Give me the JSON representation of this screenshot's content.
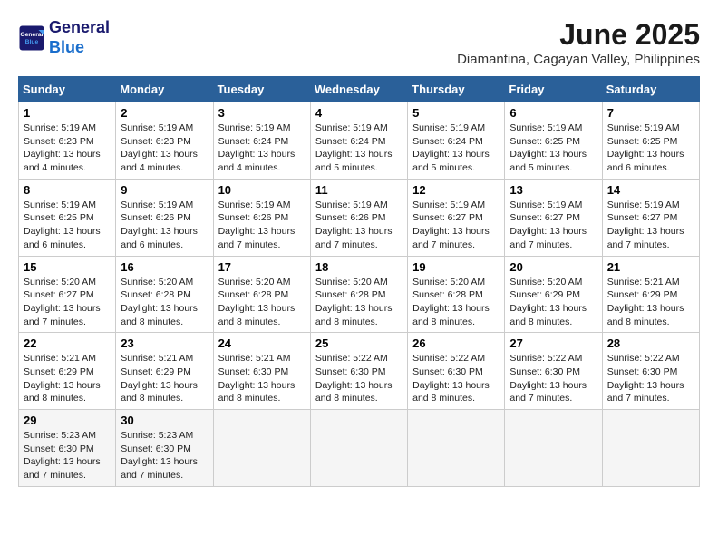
{
  "logo": {
    "line1": "General",
    "line2": "Blue"
  },
  "title": "June 2025",
  "subtitle": "Diamantina, Cagayan Valley, Philippines",
  "days_of_week": [
    "Sunday",
    "Monday",
    "Tuesday",
    "Wednesday",
    "Thursday",
    "Friday",
    "Saturday"
  ],
  "weeks": [
    [
      {
        "day": "1",
        "sunrise": "5:19 AM",
        "sunset": "6:23 PM",
        "daylight": "13 hours and 4 minutes."
      },
      {
        "day": "2",
        "sunrise": "5:19 AM",
        "sunset": "6:23 PM",
        "daylight": "13 hours and 4 minutes."
      },
      {
        "day": "3",
        "sunrise": "5:19 AM",
        "sunset": "6:24 PM",
        "daylight": "13 hours and 4 minutes."
      },
      {
        "day": "4",
        "sunrise": "5:19 AM",
        "sunset": "6:24 PM",
        "daylight": "13 hours and 5 minutes."
      },
      {
        "day": "5",
        "sunrise": "5:19 AM",
        "sunset": "6:24 PM",
        "daylight": "13 hours and 5 minutes."
      },
      {
        "day": "6",
        "sunrise": "5:19 AM",
        "sunset": "6:25 PM",
        "daylight": "13 hours and 5 minutes."
      },
      {
        "day": "7",
        "sunrise": "5:19 AM",
        "sunset": "6:25 PM",
        "daylight": "13 hours and 6 minutes."
      }
    ],
    [
      {
        "day": "8",
        "sunrise": "5:19 AM",
        "sunset": "6:25 PM",
        "daylight": "13 hours and 6 minutes."
      },
      {
        "day": "9",
        "sunrise": "5:19 AM",
        "sunset": "6:26 PM",
        "daylight": "13 hours and 6 minutes."
      },
      {
        "day": "10",
        "sunrise": "5:19 AM",
        "sunset": "6:26 PM",
        "daylight": "13 hours and 7 minutes."
      },
      {
        "day": "11",
        "sunrise": "5:19 AM",
        "sunset": "6:26 PM",
        "daylight": "13 hours and 7 minutes."
      },
      {
        "day": "12",
        "sunrise": "5:19 AM",
        "sunset": "6:27 PM",
        "daylight": "13 hours and 7 minutes."
      },
      {
        "day": "13",
        "sunrise": "5:19 AM",
        "sunset": "6:27 PM",
        "daylight": "13 hours and 7 minutes."
      },
      {
        "day": "14",
        "sunrise": "5:19 AM",
        "sunset": "6:27 PM",
        "daylight": "13 hours and 7 minutes."
      }
    ],
    [
      {
        "day": "15",
        "sunrise": "5:20 AM",
        "sunset": "6:27 PM",
        "daylight": "13 hours and 7 minutes."
      },
      {
        "day": "16",
        "sunrise": "5:20 AM",
        "sunset": "6:28 PM",
        "daylight": "13 hours and 8 minutes."
      },
      {
        "day": "17",
        "sunrise": "5:20 AM",
        "sunset": "6:28 PM",
        "daylight": "13 hours and 8 minutes."
      },
      {
        "day": "18",
        "sunrise": "5:20 AM",
        "sunset": "6:28 PM",
        "daylight": "13 hours and 8 minutes."
      },
      {
        "day": "19",
        "sunrise": "5:20 AM",
        "sunset": "6:28 PM",
        "daylight": "13 hours and 8 minutes."
      },
      {
        "day": "20",
        "sunrise": "5:20 AM",
        "sunset": "6:29 PM",
        "daylight": "13 hours and 8 minutes."
      },
      {
        "day": "21",
        "sunrise": "5:21 AM",
        "sunset": "6:29 PM",
        "daylight": "13 hours and 8 minutes."
      }
    ],
    [
      {
        "day": "22",
        "sunrise": "5:21 AM",
        "sunset": "6:29 PM",
        "daylight": "13 hours and 8 minutes."
      },
      {
        "day": "23",
        "sunrise": "5:21 AM",
        "sunset": "6:29 PM",
        "daylight": "13 hours and 8 minutes."
      },
      {
        "day": "24",
        "sunrise": "5:21 AM",
        "sunset": "6:30 PM",
        "daylight": "13 hours and 8 minutes."
      },
      {
        "day": "25",
        "sunrise": "5:22 AM",
        "sunset": "6:30 PM",
        "daylight": "13 hours and 8 minutes."
      },
      {
        "day": "26",
        "sunrise": "5:22 AM",
        "sunset": "6:30 PM",
        "daylight": "13 hours and 8 minutes."
      },
      {
        "day": "27",
        "sunrise": "5:22 AM",
        "sunset": "6:30 PM",
        "daylight": "13 hours and 7 minutes."
      },
      {
        "day": "28",
        "sunrise": "5:22 AM",
        "sunset": "6:30 PM",
        "daylight": "13 hours and 7 minutes."
      }
    ],
    [
      {
        "day": "29",
        "sunrise": "5:23 AM",
        "sunset": "6:30 PM",
        "daylight": "13 hours and 7 minutes."
      },
      {
        "day": "30",
        "sunrise": "5:23 AM",
        "sunset": "6:30 PM",
        "daylight": "13 hours and 7 minutes."
      },
      null,
      null,
      null,
      null,
      null
    ]
  ],
  "labels": {
    "sunrise": "Sunrise:",
    "sunset": "Sunset:",
    "daylight": "Daylight:"
  }
}
